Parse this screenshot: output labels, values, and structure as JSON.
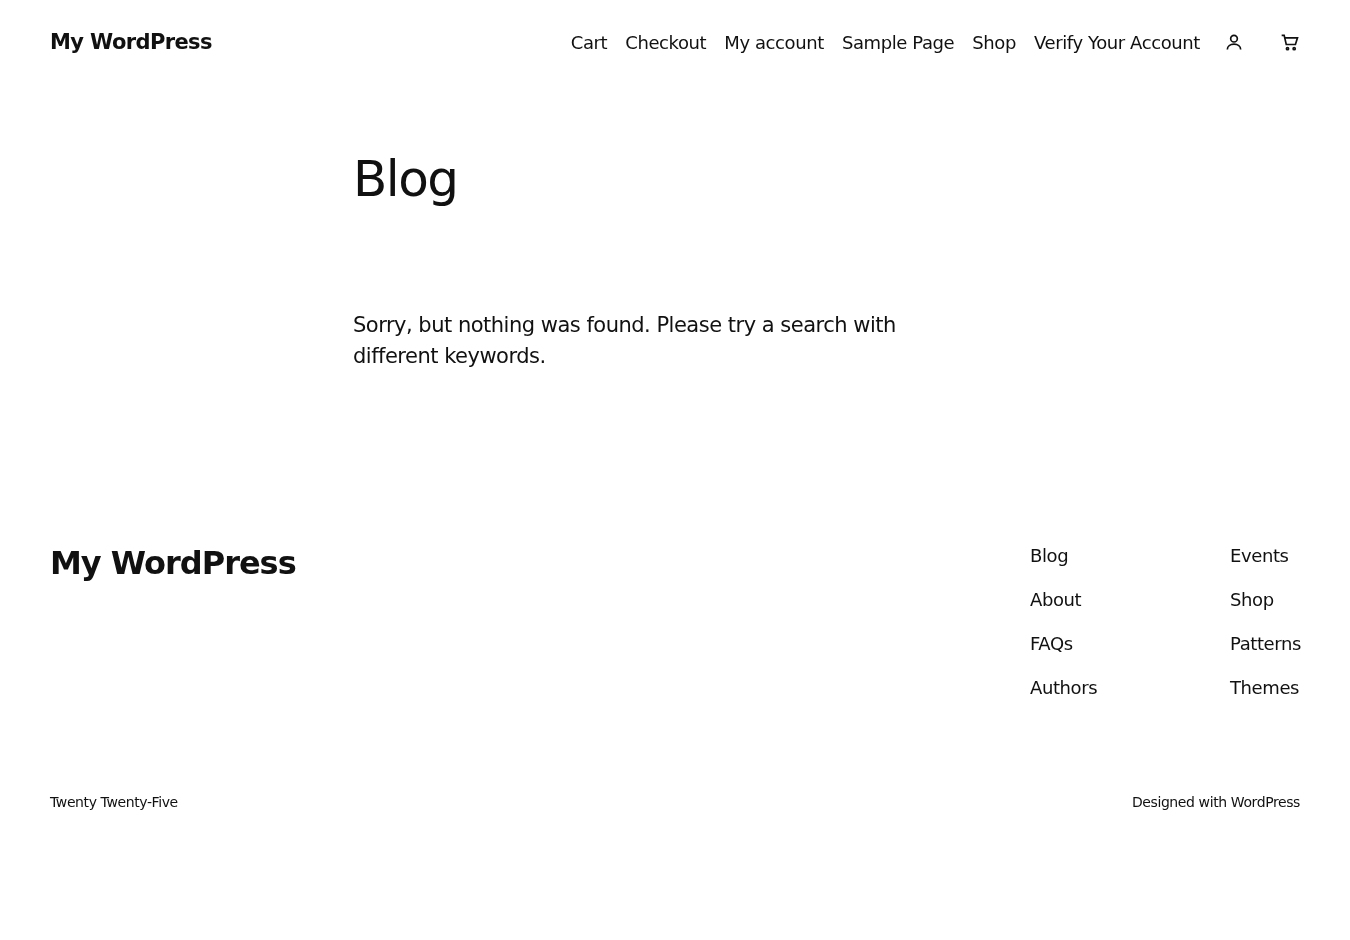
{
  "header": {
    "site_title": "My WordPress",
    "nav": [
      "Cart",
      "Checkout",
      "My account",
      "Sample Page",
      "Shop",
      "Verify Your Account"
    ]
  },
  "main": {
    "title": "Blog",
    "message": "Sorry, but nothing was found. Please try a search with different keywords."
  },
  "footer": {
    "site_title": "My WordPress",
    "columns": [
      [
        "Blog",
        "About",
        "FAQs",
        "Authors"
      ],
      [
        "Events",
        "Shop",
        "Patterns",
        "Themes"
      ]
    ],
    "theme": "Twenty Twenty-Five",
    "credit": "Designed with",
    "credit_link": "WordPress"
  }
}
